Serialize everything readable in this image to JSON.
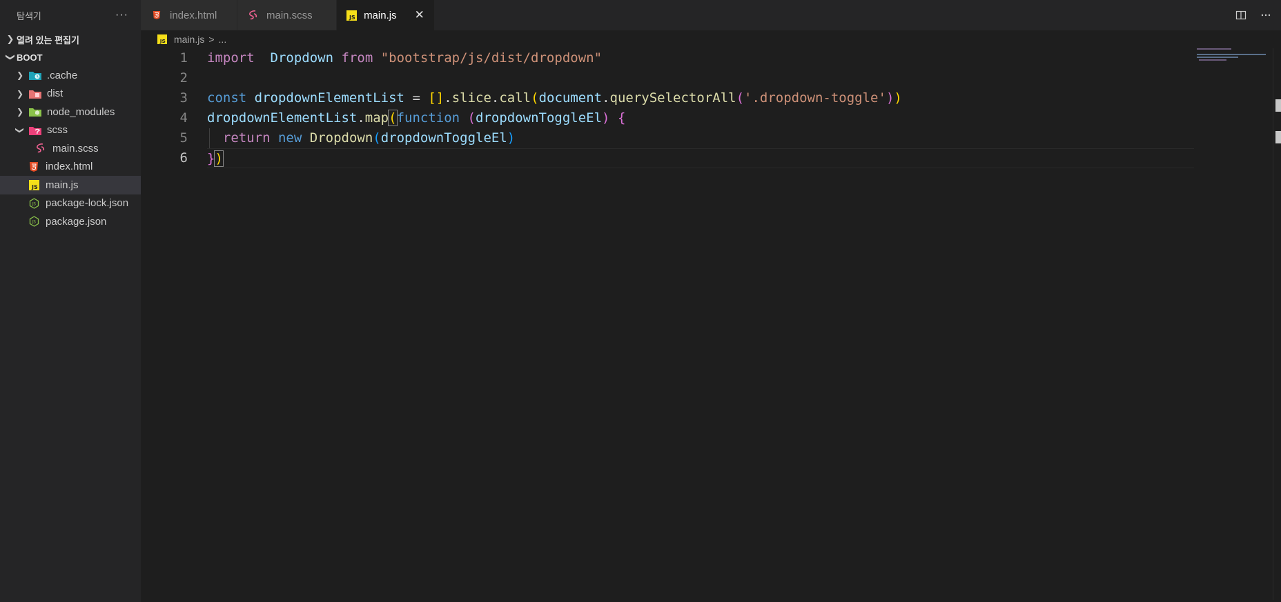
{
  "sidebar": {
    "title": "탐색기",
    "more": "···",
    "open_editors": "열려 있는 편집기",
    "root": "BOOT",
    "items": [
      {
        "label": ".cache",
        "icon": "folder-cache-icon",
        "color": "#42a5f5"
      },
      {
        "label": "dist",
        "icon": "folder-dist-icon",
        "color": "#ef5350"
      },
      {
        "label": "node_modules",
        "icon": "folder-node-icon",
        "color": "#8bc34a"
      },
      {
        "label": "scss",
        "icon": "folder-scss-icon",
        "color": "#ec407a"
      },
      {
        "label": "main.scss",
        "icon": "sass-icon",
        "color": "#f06292"
      },
      {
        "label": "index.html",
        "icon": "html5-icon",
        "color": "#e44d26"
      },
      {
        "label": "main.js",
        "icon": "js-icon",
        "color": "#f5de19"
      },
      {
        "label": "package-lock.json",
        "icon": "nodejs-icon",
        "color": "#8bc34a"
      },
      {
        "label": "package.json",
        "icon": "nodejs-icon",
        "color": "#8bc34a"
      }
    ]
  },
  "tabs": [
    {
      "label": "index.html",
      "icon": "html5-icon"
    },
    {
      "label": "main.scss",
      "icon": "sass-icon"
    },
    {
      "label": "main.js",
      "icon": "js-icon",
      "active": true
    }
  ],
  "tab_close": "✕",
  "breadcrumb": {
    "file": "main.js",
    "sep": ">",
    "rest": "..."
  },
  "editor": {
    "line_numbers": [
      "1",
      "2",
      "3",
      "4",
      "5",
      "6"
    ],
    "code": {
      "l1": {
        "import": "import",
        "name": "Dropdown",
        "from": "from",
        "path": "\"bootstrap/js/dist/dropdown\""
      },
      "l3": {
        "const": "const",
        "var": "dropdownElementList",
        "eq": "=",
        "arr": "[]",
        "dot1": ".",
        "slice": "slice",
        "dot2": ".",
        "call": "call",
        "p1": "(",
        "doc": "document",
        "dot3": ".",
        "qsa": "querySelectorAll",
        "p2": "(",
        "sel": "'.dropdown-toggle'",
        "p3": ")",
        "p4": ")"
      },
      "l4": {
        "var": "dropdownElementList",
        "dot": ".",
        "map": "map",
        "p1": "(",
        "function": "function",
        "p2": "(",
        "param": "dropdownToggleEl",
        "p3": ")",
        "brace": "{"
      },
      "l5": {
        "return": "return",
        "new": "new",
        "cls": "Dropdown",
        "p1": "(",
        "arg": "dropdownToggleEl",
        "p2": ")"
      },
      "l6": {
        "brace": "}",
        "paren": ")"
      }
    }
  },
  "colors": {
    "keyword": "#c586c0",
    "storage": "#569cd6",
    "variable": "#9cdcfe",
    "function": "#dcdcaa",
    "string": "#ce9178",
    "class": "#4ec9b0"
  }
}
